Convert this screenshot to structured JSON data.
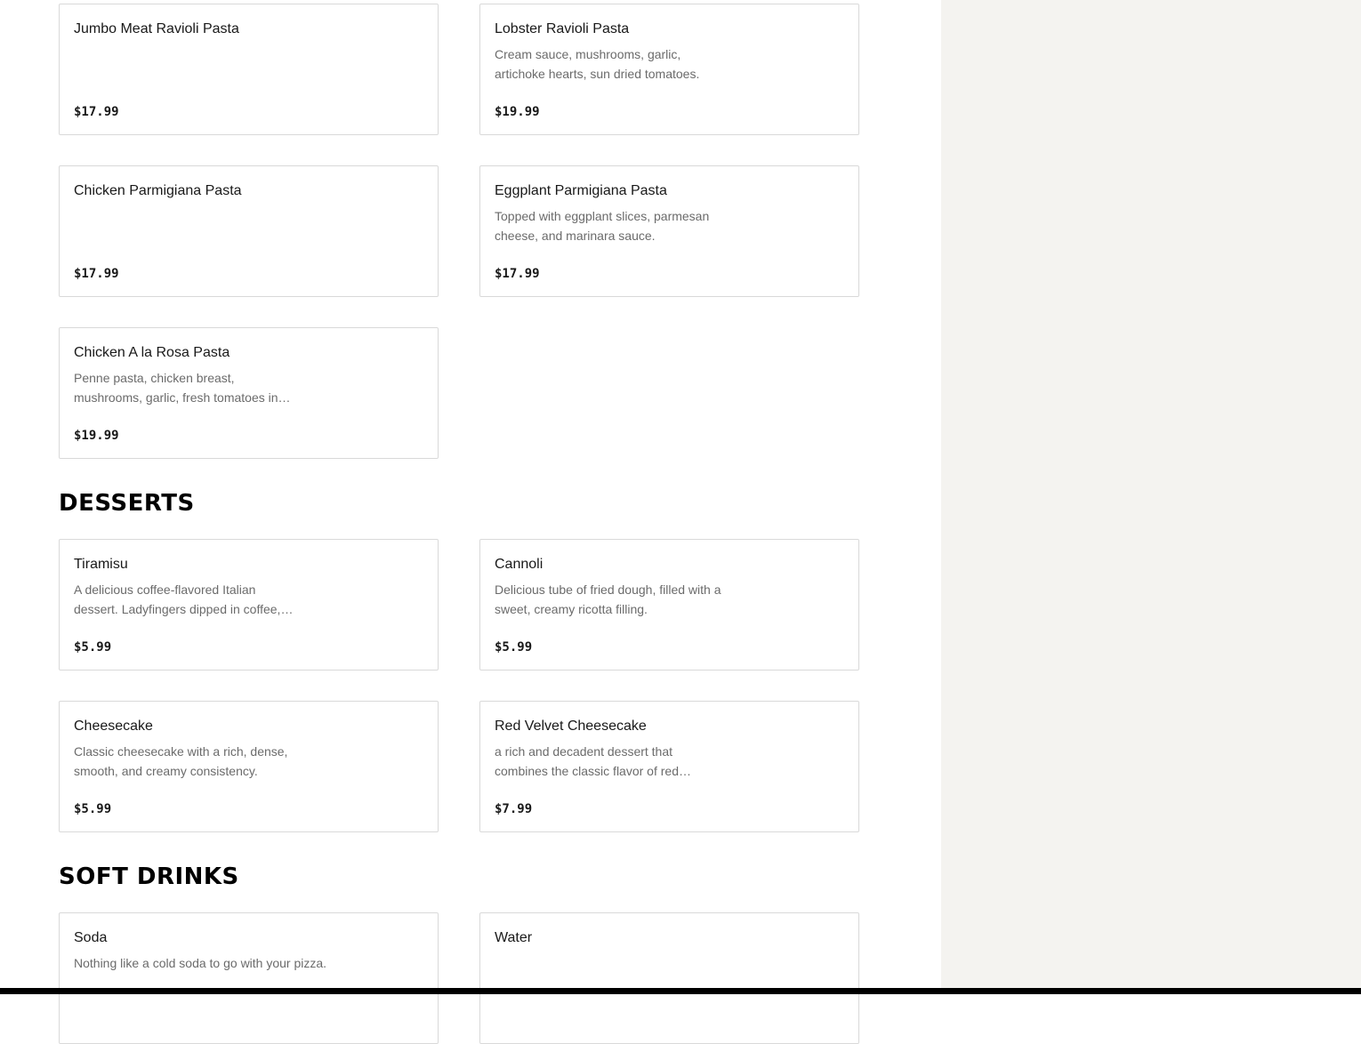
{
  "sections": {
    "pasta": {
      "items": [
        {
          "name": "Jumbo Meat Ravioli Pasta",
          "description": "",
          "price": "$17.99"
        },
        {
          "name": "Lobster Ravioli Pasta",
          "description": "Cream sauce, mushrooms, garlic, artichoke hearts, sun dried tomatoes.",
          "price": "$19.99"
        },
        {
          "name": "Chicken Parmigiana Pasta",
          "description": "",
          "price": "$17.99"
        },
        {
          "name": "Eggplant Parmigiana Pasta",
          "description": "Topped with eggplant slices, parmesan cheese, and marinara sauce.",
          "price": "$17.99"
        },
        {
          "name": "Chicken A la Rosa Pasta",
          "description": "Penne pasta, chicken breast, mushrooms, garlic, fresh tomatoes in…",
          "price": "$19.99"
        }
      ]
    },
    "desserts": {
      "title": "DESSERTS",
      "items": [
        {
          "name": "Tiramisu",
          "description": "A delicious coffee-flavored Italian dessert. Ladyfingers dipped in coffee,…",
          "price": "$5.99"
        },
        {
          "name": "Cannoli",
          "description": "Delicious tube of fried dough, filled with a sweet, creamy ricotta filling.",
          "price": "$5.99"
        },
        {
          "name": "Cheesecake",
          "description": "Classic cheesecake with a rich, dense, smooth, and creamy consistency.",
          "price": "$5.99"
        },
        {
          "name": "Red Velvet Cheesecake",
          "description": "a rich and decadent dessert that combines the classic flavor of red…",
          "price": "$7.99"
        }
      ]
    },
    "soft_drinks": {
      "title": "SOFT DRINKS",
      "items": [
        {
          "name": "Soda",
          "description": "Nothing like a cold soda to go with your pizza.",
          "price": ""
        },
        {
          "name": "Water",
          "description": "",
          "price": ""
        }
      ]
    }
  }
}
